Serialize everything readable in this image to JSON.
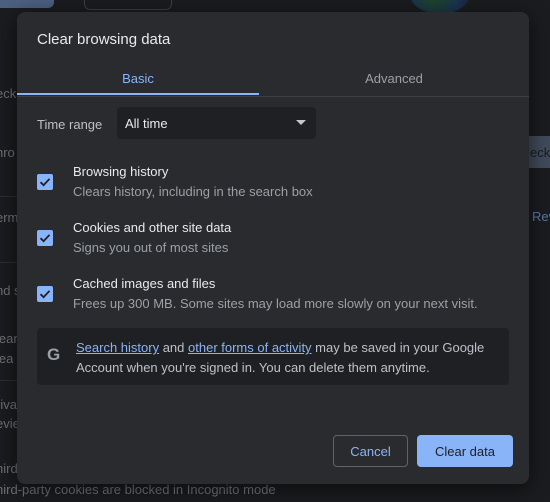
{
  "background": {
    "fragments": [
      "eck",
      "hro",
      "erm",
      "nd s",
      "lear",
      "lea",
      "rivac",
      "evie",
      "hird",
      "eck",
      "Rev"
    ],
    "footer_text": "hird-party cookies are blocked in Incognito mode"
  },
  "dialog": {
    "title": "Clear browsing data",
    "tabs": [
      {
        "label": "Basic",
        "active": true
      },
      {
        "label": "Advanced",
        "active": false
      }
    ],
    "time_range": {
      "label": "Time range",
      "selected": "All time"
    },
    "options": [
      {
        "title": "Browsing history",
        "description": "Clears history, including in the search box",
        "checked": true
      },
      {
        "title": "Cookies and other site data",
        "description": "Signs you out of most sites",
        "checked": true
      },
      {
        "title": "Cached images and files",
        "description": "Frees up 300 MB. Some sites may load more slowly on your next visit.",
        "checked": true
      }
    ],
    "info": {
      "icon": "google-g-icon",
      "link1": "Search history",
      "text1": " and ",
      "link2": "other forms of activity",
      "text2": " may be saved in your Google Account when you're signed in. You can delete them anytime."
    },
    "buttons": {
      "cancel": "Cancel",
      "clear": "Clear data"
    }
  },
  "colors": {
    "accent": "#8ab4f8",
    "dialog_bg": "#2a2b2e",
    "page_bg": "#1b1c1f"
  }
}
